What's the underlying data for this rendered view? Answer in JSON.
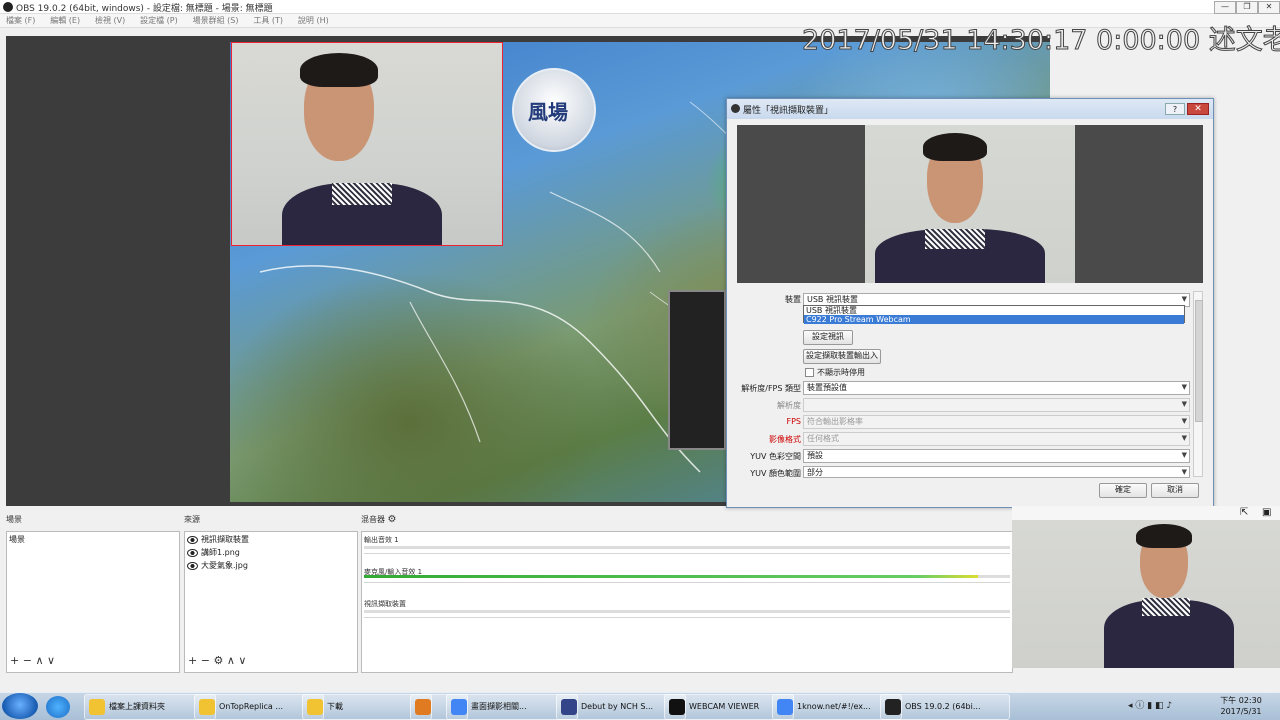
{
  "window": {
    "title": "OBS 19.0.2 (64bit, windows) - 設定檔: 無標題 - 場景: 無標題",
    "controls": [
      "—",
      "❐",
      "✕"
    ]
  },
  "menu": [
    "檔案 (F)",
    "編輯 (E)",
    "檢視 (V)",
    "設定檔 (P)",
    "場景群組 (S)",
    "工具 (T)",
    "說明 (H)"
  ],
  "overlay_text": "2017/05/31 14:30:17 0:00:00 述文老師",
  "scene_bubble": "風場",
  "dialog": {
    "title": "屬性「視訊擷取裝置」",
    "help_label": "?",
    "close_label": "✕",
    "device_label": "裝置",
    "device_value": "USB 視訊裝置",
    "device_options": [
      "USB 視訊裝置",
      "C922 Pro Stream Webcam"
    ],
    "configure_video_label": "設定視訊",
    "configure_crossbar_label": "設定擷取裝置輸出入",
    "deactivate_label": "不顯示時停用",
    "res_type_label": "解析度/FPS 類型",
    "res_type_value": "裝置預設值",
    "resolution_label": "解析度",
    "resolution_value": "",
    "fps_label": "FPS",
    "fps_value": "符合輸出影格率",
    "video_format_label": "影像格式",
    "video_format_value": "任何格式",
    "yuv_space_label": "YUV 色彩空間",
    "yuv_space_value": "預設",
    "yuv_range_label": "YUV 顏色範圍",
    "yuv_range_value": "部分",
    "ok_label": "確定",
    "cancel_label": "取消"
  },
  "docks": {
    "scenes_title": "場景",
    "scenes": [
      "場景"
    ],
    "sources_title": "來源",
    "sources": [
      "視訊擷取裝置",
      "講師1.png",
      "大愛氣象.jpg"
    ],
    "mixer_title": "混音器",
    "mixer": [
      {
        "name": "輸出音效 1",
        "level": 0
      },
      {
        "name": "麥克風/輸入音效 1",
        "level": 0.95
      },
      {
        "name": "視訊擷取裝置",
        "level": 0
      }
    ],
    "foot_icons": [
      "+",
      "−",
      "∧",
      "∨"
    ],
    "sources_foot_icons": [
      "+",
      "−",
      "⚙",
      "∧",
      "∨"
    ]
  },
  "taskbar": {
    "items": [
      {
        "label": "檔案上課資料夾",
        "icon": "folder-icon",
        "color": "#f1c232"
      },
      {
        "label": "OnTopReplica ...",
        "icon": "folder-icon",
        "color": "#f1c232"
      },
      {
        "label": "下載",
        "icon": "folder-icon",
        "color": "#f1c232"
      },
      {
        "label": "",
        "icon": "media-icon",
        "color": "#e07b22"
      },
      {
        "label": "畫面擷影相關...",
        "icon": "chrome-icon",
        "color": "#4285f4"
      },
      {
        "label": "Debut by NCH S...",
        "icon": "debut-icon",
        "color": "#334488"
      },
      {
        "label": "WEBCAM VIEWER",
        "icon": "camera-icon",
        "color": "#111111"
      },
      {
        "label": "1know.net/#!/ex...",
        "icon": "chrome-icon",
        "color": "#4285f4"
      },
      {
        "label": "OBS 19.0.2 (64bi...",
        "icon": "obs-icon",
        "color": "#222222"
      }
    ],
    "time": "下午 02:30",
    "date": "2017/5/31"
  }
}
